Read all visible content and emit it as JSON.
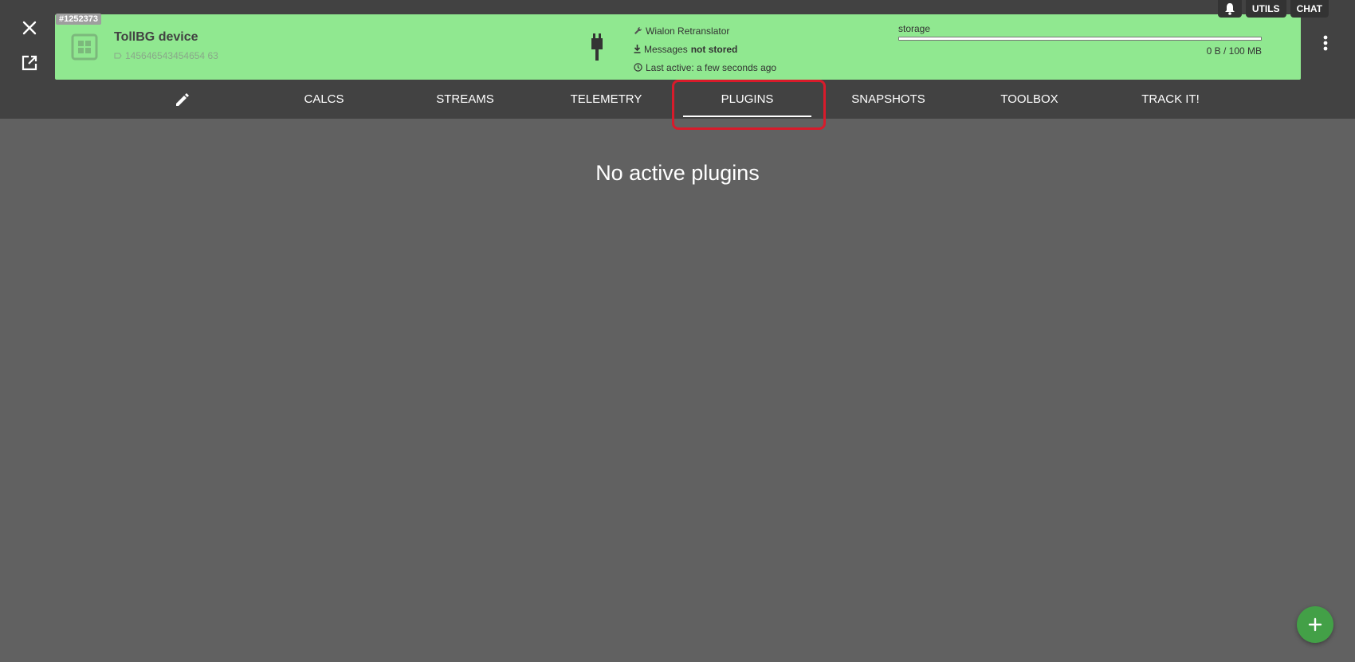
{
  "colors": {
    "accent_green": "#90e890",
    "header_dark": "#424242",
    "content_bg": "#616161",
    "highlight_red": "#d81b2b",
    "fab_green": "#43a047"
  },
  "top_right": {
    "utils_label": "UTILS",
    "chat_label": "CHAT"
  },
  "device": {
    "id_badge": "#1252373",
    "name": "TollBG device",
    "ident": "145646543454654 63",
    "protocol": "Wialon Retranslator",
    "messages_prefix": "Messages",
    "messages_status": "not stored",
    "last_active": "Last active: a few seconds ago",
    "storage_label": "storage",
    "storage_value": "0 B / 100 MB",
    "storage_used_fraction": 0.0
  },
  "tabs": [
    {
      "label": "CALCS"
    },
    {
      "label": "STREAMS"
    },
    {
      "label": "TELEMETRY"
    },
    {
      "label": "PLUGINS"
    },
    {
      "label": "SNAPSHOTS"
    },
    {
      "label": "TOOLBOX"
    },
    {
      "label": "TRACK IT!"
    }
  ],
  "active_tab": "PLUGINS",
  "main": {
    "empty_message": "No active plugins"
  },
  "icons": {
    "close": "close-icon",
    "open_new": "open-in-new-icon",
    "device": "device-chip-icon",
    "plug": "plug-icon",
    "wrench": "wrench-icon",
    "download": "download-icon",
    "clock": "clock-icon",
    "kebab": "more-vert-icon",
    "bell": "bell-icon",
    "edit": "pencil-icon",
    "add": "plus-icon"
  }
}
